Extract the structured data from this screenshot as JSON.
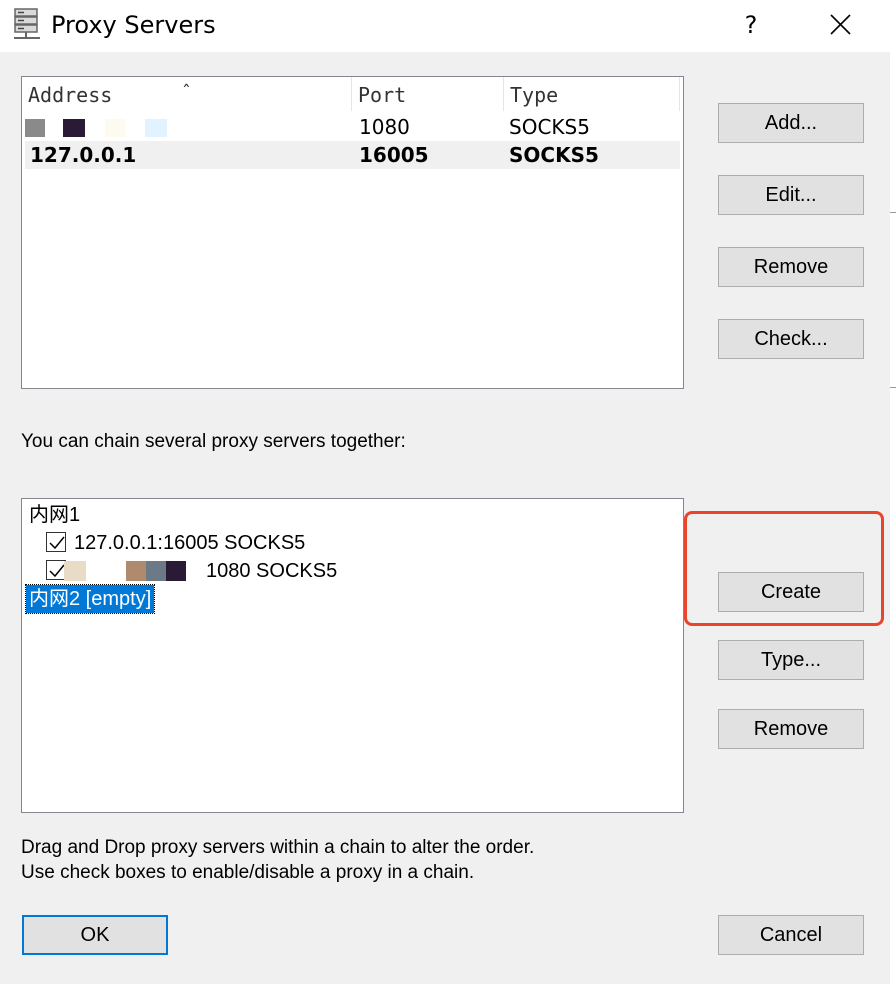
{
  "window": {
    "title": "Proxy Servers",
    "help_label": "?",
    "icons": {
      "app": "server-icon",
      "close": "close-icon",
      "sort": "sort-up-icon"
    }
  },
  "proxy_list": {
    "columns": [
      "Address",
      "Port",
      "Type"
    ],
    "rows": [
      {
        "address": "",
        "port": "1080",
        "type": "SOCKS5"
      },
      {
        "address": "127.0.0.1",
        "port": "16005",
        "type": "SOCKS5"
      }
    ]
  },
  "proxy_buttons": {
    "add": "Add...",
    "edit": "Edit...",
    "remove": "Remove",
    "check": "Check..."
  },
  "chain_label": "You can chain several proxy servers together:",
  "chains": [
    {
      "name": "内网1",
      "items": [
        {
          "text": "127.0.0.1:16005 SOCKS5",
          "checked": true
        },
        {
          "text": "1080 SOCKS5",
          "checked": true
        }
      ]
    },
    {
      "name": "内网2 [empty]",
      "selected": true
    }
  ],
  "chain_buttons": {
    "create": "Create",
    "type": "Type...",
    "remove": "Remove"
  },
  "hints": {
    "line1": "Drag and Drop proxy servers within a chain to alter the order.",
    "line2": "Use check boxes to enable/disable a proxy in a chain."
  },
  "footer": {
    "ok": "OK",
    "cancel": "Cancel"
  },
  "colors": {
    "accent": "#0078d7",
    "annotation": "#e8452c",
    "button_face": "#e1e1e1",
    "dialog_bg": "#f0f0f0"
  }
}
